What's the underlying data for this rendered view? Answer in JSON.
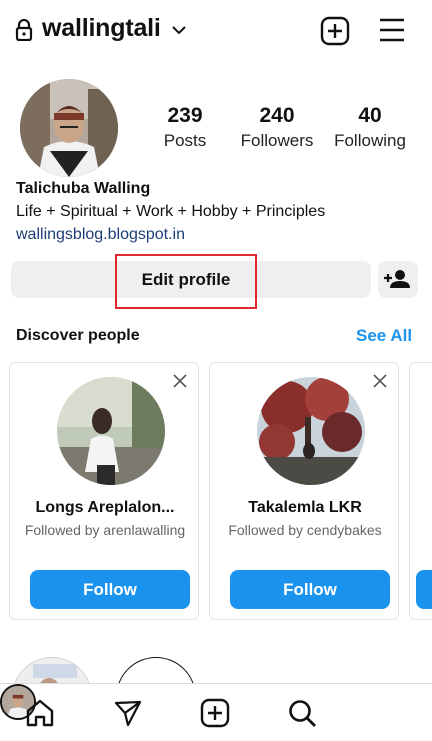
{
  "header": {
    "username": "wallingtali",
    "icons": [
      "lock-icon",
      "chevron-down-icon",
      "new-post-icon",
      "menu-icon"
    ]
  },
  "profile": {
    "stats": [
      {
        "value": "239",
        "label": "Posts"
      },
      {
        "value": "240",
        "label": "Followers"
      },
      {
        "value": "40",
        "label": "Following"
      }
    ],
    "name": "Talichuba Walling",
    "bio": "Life + Spiritual + Work + Hobby + Principles",
    "link": "wallingsblog.blogspot.in",
    "edit_label": "Edit profile",
    "highlight_color": "#e2262d"
  },
  "discover": {
    "title": "Discover people",
    "see_all": "See All",
    "cards": [
      {
        "name": "Longs Areplalon...",
        "subtitle": "Followed by arenlawalling",
        "button": "Follow"
      },
      {
        "name": "Takalemla LKR",
        "subtitle": "Followed by cendybakes",
        "button": "Follow"
      }
    ]
  },
  "nav": {
    "items": [
      "home-icon",
      "direct-message-icon",
      "create-icon",
      "search-icon",
      "profile-avatar"
    ]
  },
  "colors": {
    "accent": "#1a93ee",
    "link": "#1d3d78",
    "button_bg": "#efefef"
  }
}
